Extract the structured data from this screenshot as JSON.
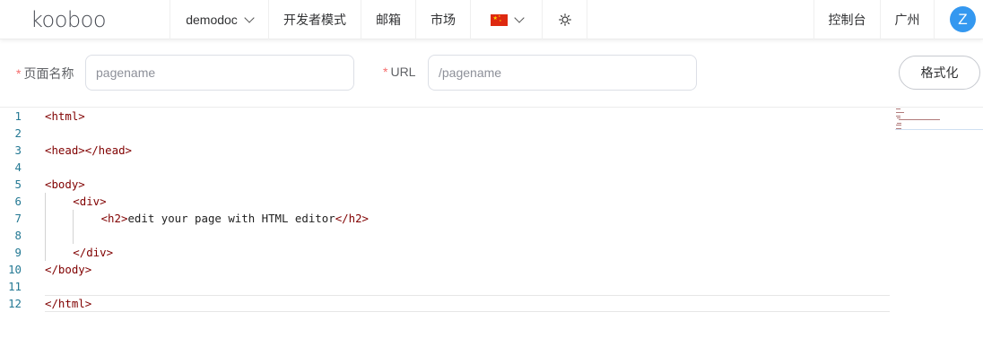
{
  "brand": {
    "logo_text": "kooboo"
  },
  "header": {
    "site_selector": "demodoc",
    "developer_mode": "开发者模式",
    "mailbox": "邮箱",
    "market": "市场",
    "language_flag": "china-flag-icon",
    "theme_icon": "sun-icon",
    "console": "控制台",
    "region": "广州",
    "user_initial": "Z"
  },
  "form": {
    "page_name_required": "*",
    "page_name_label": "页面名称",
    "page_name_placeholder": "pagename",
    "url_required": "*",
    "url_label": "URL",
    "url_placeholder": "/pagename",
    "format_button": "格式化"
  },
  "editor": {
    "lines": [
      {
        "number": "1",
        "indent": 0,
        "text": "<html>"
      },
      {
        "number": "2",
        "indent": 0,
        "text": ""
      },
      {
        "number": "3",
        "indent": 0,
        "text": "<head></head>"
      },
      {
        "number": "4",
        "indent": 0,
        "text": ""
      },
      {
        "number": "5",
        "indent": 0,
        "text": "<body>"
      },
      {
        "number": "6",
        "indent": 1,
        "text": "<div>"
      },
      {
        "number": "7",
        "indent": 2,
        "text": "<h2>edit your page with HTML editor</h2>"
      },
      {
        "number": "8",
        "indent": 0,
        "text": ""
      },
      {
        "number": "9",
        "indent": 1,
        "text": "</div>"
      },
      {
        "number": "10",
        "indent": 0,
        "text": "</body>"
      },
      {
        "number": "11",
        "indent": 0,
        "text": ""
      },
      {
        "number": "12",
        "indent": 0,
        "text": "</html>"
      }
    ],
    "current_line": "12",
    "colors": {
      "tag": "#800000",
      "text": "#222222",
      "line_number": "#237893"
    }
  }
}
